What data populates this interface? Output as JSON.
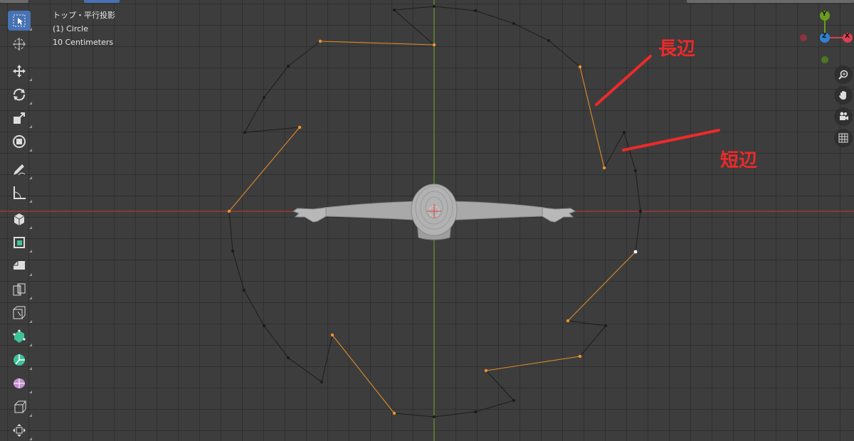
{
  "viewport_info": {
    "view_name": "トップ・平行投影",
    "object_label": "(1) Circle",
    "scale_label": "10 Centimeters"
  },
  "gizmo": {
    "y_label": "Y",
    "z_label": "Z",
    "x_label": "X",
    "colors": {
      "y": "#6a9b1f",
      "z": "#2f83d6",
      "x": "#d84050"
    }
  },
  "annotations": {
    "long_edge_label": "長辺",
    "short_edge_label": "短辺",
    "color": "#ec2a2a"
  },
  "toolbar": {
    "tools": [
      {
        "name": "select-box-tool-button",
        "icon": "select-box-icon",
        "active": true
      },
      {
        "name": "cursor-tool-button",
        "icon": "cursor-icon",
        "active": false
      },
      {
        "name": "move-tool-button",
        "icon": "move-icon",
        "active": false
      },
      {
        "name": "rotate-tool-button",
        "icon": "rotate-icon",
        "active": false
      },
      {
        "name": "scale-tool-button",
        "icon": "scale-icon",
        "active": false
      },
      {
        "name": "transform-tool-button",
        "icon": "transform-icon",
        "active": false
      },
      {
        "name": "annotate-tool-button",
        "icon": "annotate-icon",
        "active": false
      },
      {
        "name": "measure-tool-button",
        "icon": "measure-icon",
        "active": false
      },
      {
        "name": "add-cube-tool-button",
        "icon": "add-cube-icon",
        "active": false
      },
      {
        "name": "extrude-region-tool-button",
        "icon": "extrude-region-icon",
        "active": false
      },
      {
        "name": "inset-faces-tool-button",
        "icon": "inset-faces-icon",
        "active": false
      },
      {
        "name": "bevel-tool-button",
        "icon": "bevel-icon",
        "active": false
      },
      {
        "name": "loop-cut-tool-button",
        "icon": "loop-cut-icon",
        "active": false
      },
      {
        "name": "knife-tool-button",
        "icon": "knife-icon",
        "active": false
      },
      {
        "name": "poly-build-tool-button",
        "icon": "poly-build-icon",
        "active": false
      },
      {
        "name": "spin-tool-button",
        "icon": "spin-icon",
        "active": false
      },
      {
        "name": "smooth-tool-button",
        "icon": "smooth-icon",
        "active": false
      },
      {
        "name": "edge-slide-tool-button",
        "icon": "edge-slide-icon",
        "active": false
      },
      {
        "name": "shrink-fatten-tool-button",
        "icon": "shrink-fatten-icon",
        "active": false
      }
    ]
  },
  "nav_buttons": [
    {
      "name": "zoom-view-button",
      "icon": "zoom-icon"
    },
    {
      "name": "pan-view-button",
      "icon": "hand-icon"
    },
    {
      "name": "camera-view-button",
      "icon": "camera-icon"
    },
    {
      "name": "ortho-toggle-button",
      "icon": "grid-icon"
    }
  ],
  "colors": {
    "grid_bg": "#3d3d3d",
    "x_axis": "#b33a3a",
    "y_axis": "#6c9b2c",
    "edge_selected": "#e08b2b",
    "edge_unselected": "#1e1e1e",
    "active_tool": "#4772b3"
  }
}
